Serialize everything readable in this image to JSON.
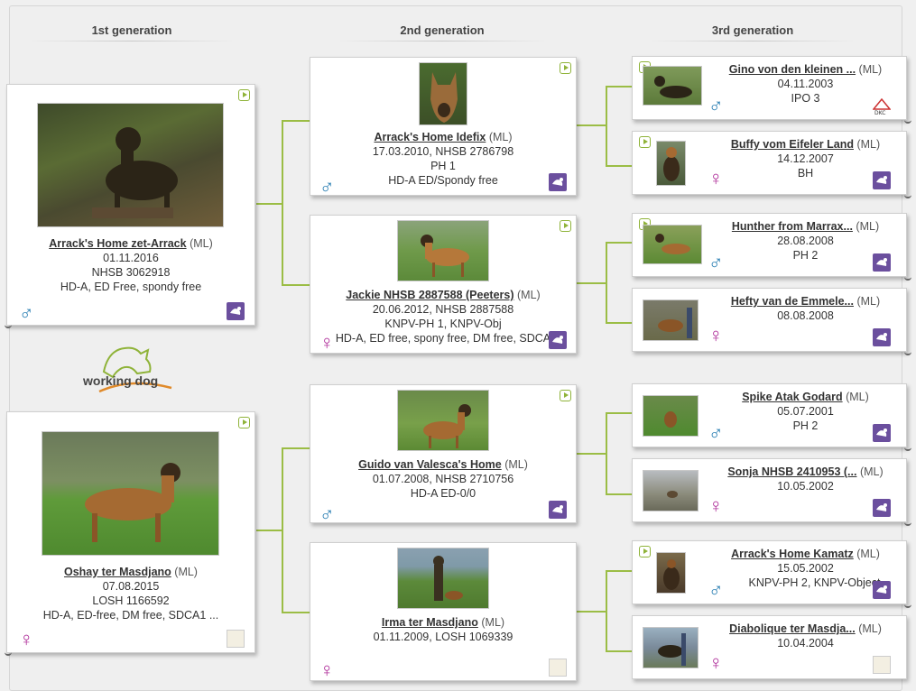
{
  "headers": {
    "gen1": "1st generation",
    "gen2": "2nd generation",
    "gen3": "3rd generation"
  },
  "brand": {
    "logo_text": "working dog",
    "accent": "#8fb339"
  },
  "gen1": [
    {
      "name": "Arrack's Home zet-Arrack",
      "ml": "(ML)",
      "l1": "01.11.2016",
      "l2": "NHSB 3062918",
      "l3": "HD-A, ED Free, spondy free",
      "sex": "♂"
    },
    {
      "name": "Oshay ter Masdjano",
      "ml": "(ML)",
      "l1": "07.08.2015",
      "l2": "LOSH 1166592",
      "l3": "HD-A, ED-free, DM free, SDCA1 ...",
      "sex": "♀"
    }
  ],
  "gen2": [
    {
      "name": "Arrack's Home Idefix",
      "ml": "(ML)",
      "l1": "17.03.2010, NHSB 2786798",
      "l2": "PH 1",
      "l3": "HD-A ED/Spondy free",
      "sex": "♂"
    },
    {
      "name": "Jackie NHSB 2887588 (Peeters)",
      "ml": "(ML)",
      "l1": "20.06.2012, NHSB 2887588",
      "l2": "KNPV-PH 1, KNPV-Obj",
      "l3": "HD-A, ED free, spony free, DM free, SDCA",
      "sex": "♀"
    },
    {
      "name": "Guido van Valesca's Home",
      "ml": "(ML)",
      "l1": "01.07.2008, NHSB 2710756",
      "l2": "HD-A ED-0/0",
      "l3": "",
      "sex": "♂"
    },
    {
      "name": "Irma ter Masdjano",
      "ml": "(ML)",
      "l1": "01.11.2009, LOSH 1069339",
      "l2": "",
      "l3": "",
      "sex": "♀"
    }
  ],
  "gen3": [
    {
      "name": "Gino von den kleinen ...",
      "ml": "(ML)",
      "l1": "04.11.2003",
      "l2": "IPO 3",
      "sex": "♂"
    },
    {
      "name": "Buffy vom Eifeler Land",
      "ml": "(ML)",
      "l1": "14.12.2007",
      "l2": "BH",
      "sex": "♀"
    },
    {
      "name": "Hunther from Marrax...",
      "ml": "(ML)",
      "l1": "28.08.2008",
      "l2": "PH 2",
      "sex": "♂"
    },
    {
      "name": "Hefty van de Emmele...",
      "ml": "(ML)",
      "l1": "08.08.2008",
      "l2": "",
      "sex": "♀"
    },
    {
      "name": "Spike Atak Godard",
      "ml": "(ML)",
      "l1": "05.07.2001",
      "l2": "PH 2",
      "sex": "♂"
    },
    {
      "name": "Sonja NHSB 2410953 (...",
      "ml": "(ML)",
      "l1": "10.05.2002",
      "l2": "",
      "sex": "♀"
    },
    {
      "name": "Arrack's Home Kamatz",
      "ml": "(ML)",
      "l1": "15.05.2002",
      "l2": "KNPV-PH 2, KNPV-Object",
      "sex": "♂"
    },
    {
      "name": "Diabolique ter Masdja...",
      "ml": "(ML)",
      "l1": "10.04.2004",
      "l2": "",
      "sex": "♀"
    }
  ]
}
